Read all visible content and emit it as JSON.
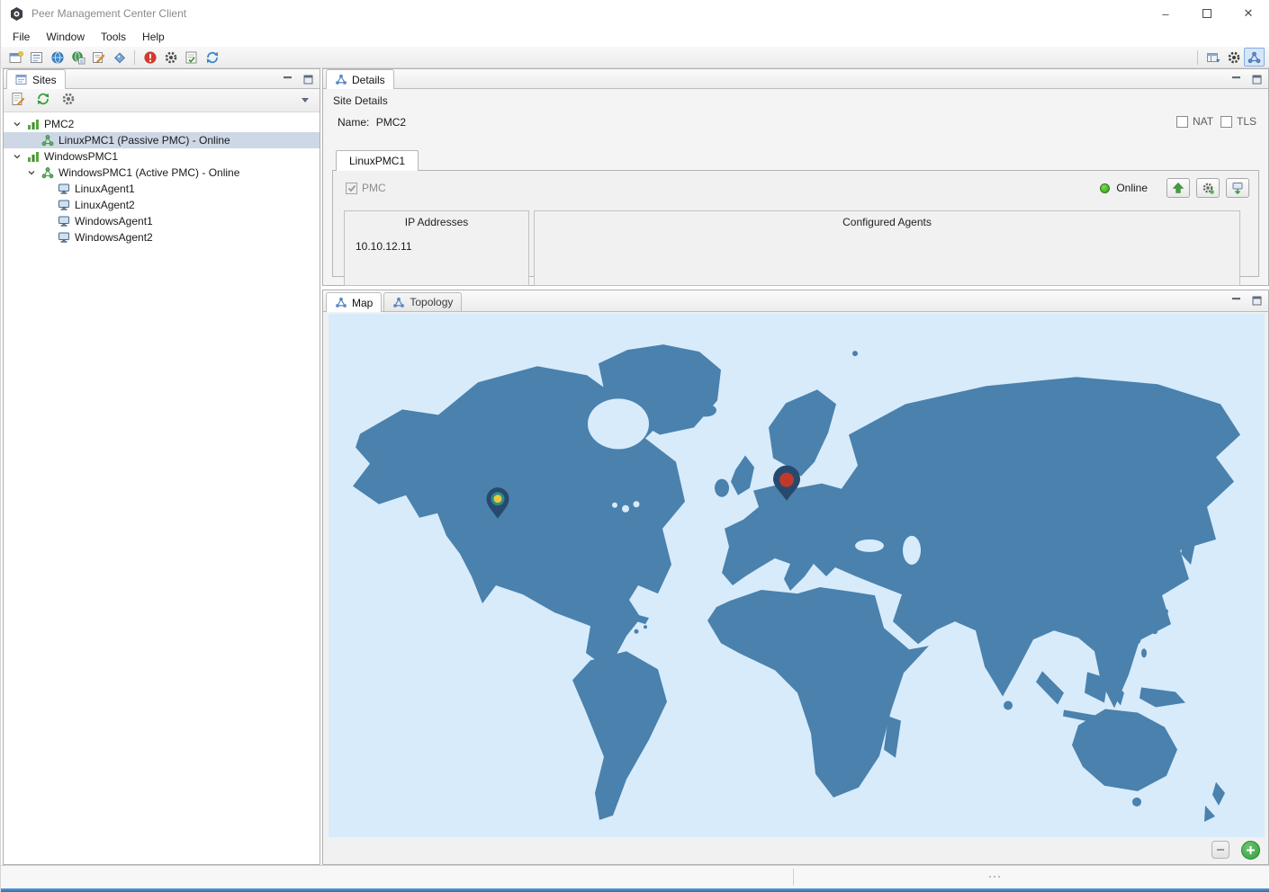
{
  "window": {
    "title": "Peer Management Center Client",
    "minimize_glyph": "–",
    "close_glyph": "✕"
  },
  "menu": {
    "items": [
      {
        "label": "File"
      },
      {
        "label": "Window"
      },
      {
        "label": "Tools"
      },
      {
        "label": "Help"
      }
    ]
  },
  "main_toolbar": {
    "left_icons": [
      "new-wizard-icon",
      "show-view-icon",
      "web-browser-icon",
      "web-publish-icon",
      "edit-properties-icon",
      "tags-icon",
      "alerts-icon",
      "preferences-gear-icon",
      "tasks-icon",
      "refresh-icon"
    ],
    "right_icons": [
      "open-perspective-icon",
      "settings-gear-icon",
      "topology-perspective-icon"
    ],
    "active_tool": "topology-perspective"
  },
  "sites_panel": {
    "tab_label": "Sites",
    "toolbar_icons": [
      "report-icon",
      "refresh-sites-icon",
      "site-settings-gear-icon",
      "view-menu-icon"
    ],
    "tree": [
      {
        "label": "PMC2",
        "level": 0,
        "expanded": true,
        "icon": "site-icon",
        "selected": false
      },
      {
        "label": "LinuxPMC1 (Passive PMC) - Online",
        "level": 1,
        "icon": "pmc-icon",
        "selected": true
      },
      {
        "label": "WindowsPMC1",
        "level": 0,
        "expanded": true,
        "icon": "site-icon",
        "selected": false
      },
      {
        "label": "WindowsPMC1 (Active PMC) - Online",
        "level": 1,
        "expanded": true,
        "icon": "pmc-icon",
        "selected": false
      },
      {
        "label": "LinuxAgent1",
        "level": 2,
        "icon": "agent-icon",
        "selected": false
      },
      {
        "label": "LinuxAgent2",
        "level": 2,
        "icon": "agent-icon",
        "selected": false
      },
      {
        "label": "WindowsAgent1",
        "level": 2,
        "icon": "agent-icon",
        "selected": false
      },
      {
        "label": "WindowsAgent2",
        "level": 2,
        "icon": "agent-icon",
        "selected": false
      }
    ]
  },
  "details_panel": {
    "tab_label": "Details",
    "section_title": "Site Details",
    "name_label": "Name:",
    "name_value": "PMC2",
    "nat_checkbox": {
      "label": "NAT",
      "checked": false
    },
    "tls_checkbox": {
      "label": "TLS",
      "checked": false
    },
    "inner_tab_label": "LinuxPMC1",
    "pmc_checkbox": {
      "label": "PMC",
      "checked": true,
      "disabled": true
    },
    "status": {
      "label": "Online",
      "color": "#3dae2b"
    },
    "action_buttons": [
      "promote-up-icon",
      "agent-gear-icon",
      "install-download-icon"
    ],
    "ip_group": {
      "title": "IP Addresses",
      "value": "10.10.12.11"
    },
    "agents_group": {
      "title": "Configured Agents",
      "value": ""
    }
  },
  "map_panel": {
    "map_tab_label": "Map",
    "topology_tab_label": "Topology",
    "sea_color": "#d7ebfb",
    "land_color": "#4a81ad",
    "pins": [
      {
        "name": "united-states",
        "outer_color": "#27496d",
        "ring_color": "#2e8b8b",
        "core_color": "#e8c93e"
      },
      {
        "name": "europe",
        "outer_color": "#27496d",
        "core_color": "#c0392b"
      }
    ]
  }
}
